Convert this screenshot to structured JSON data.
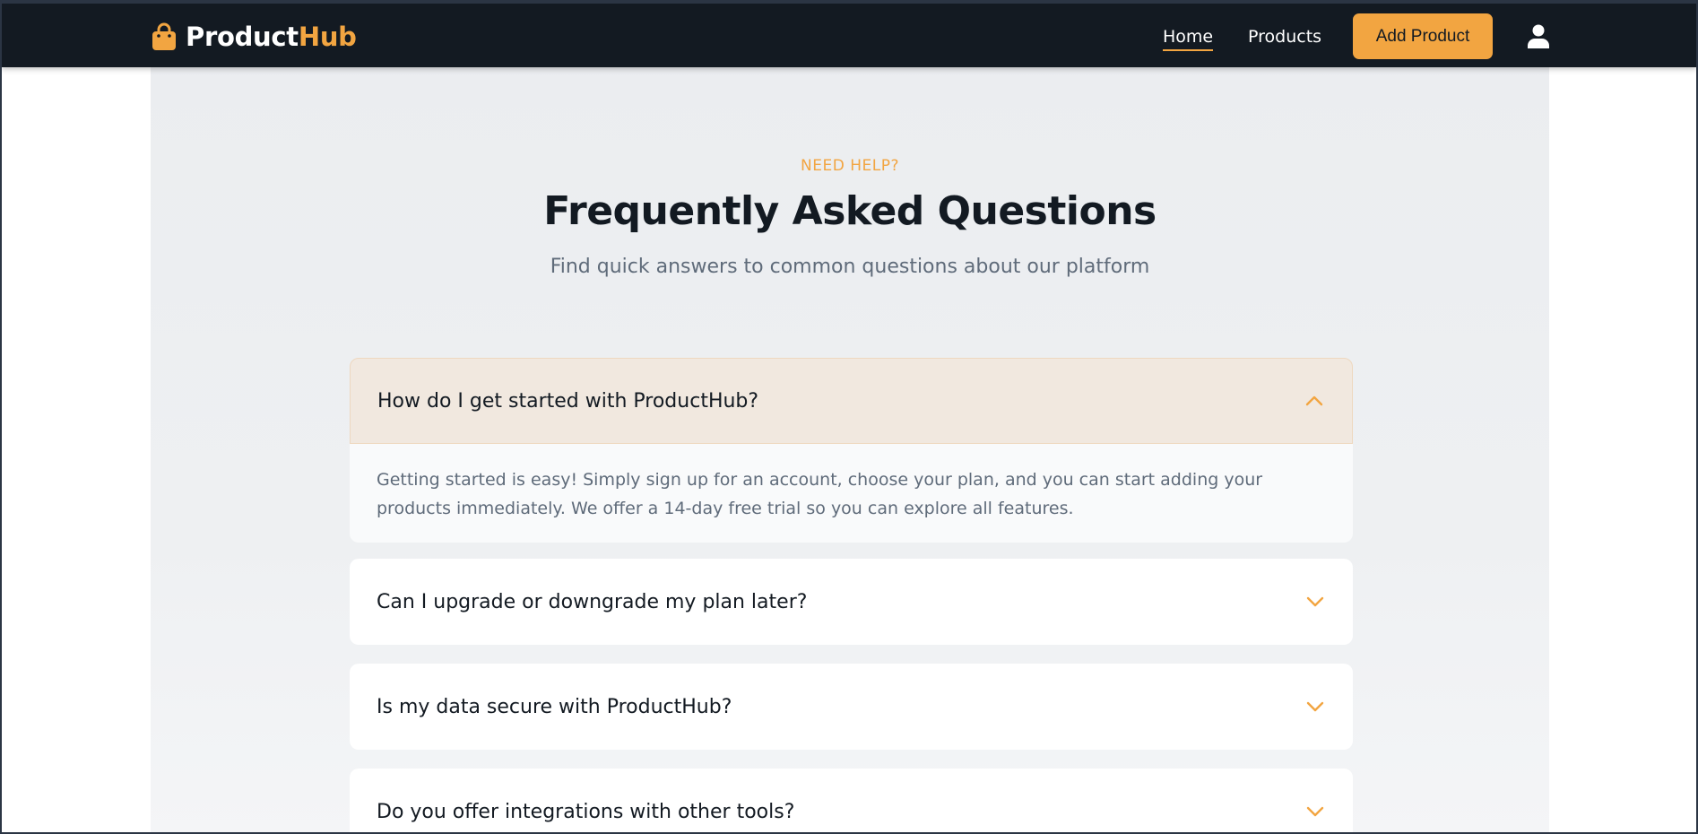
{
  "nav": {
    "logo_main": "Product",
    "logo_accent": "Hub",
    "home": "Home",
    "products": "Products",
    "add_product": "Add Product",
    "user_icon": "user-icon",
    "brand_color": "#f2a541"
  },
  "hero": {
    "eyebrow": "NEED HELP?",
    "title": "Frequently Asked Questions",
    "subtitle": "Find quick answers to common questions about our platform"
  },
  "faqs": [
    {
      "question": "How do I get started with ProductHub?",
      "answer": "Getting started is easy! Simply sign up for an account, choose your plan, and you can start adding your products immediately. We offer a 14-day free trial so you can explore all features.",
      "expanded": true
    },
    {
      "question": "Can I upgrade or downgrade my plan later?",
      "expanded": false
    },
    {
      "question": "Is my data secure with ProductHub?",
      "expanded": false
    },
    {
      "question": "Do you offer integrations with other tools?",
      "expanded": false
    }
  ]
}
